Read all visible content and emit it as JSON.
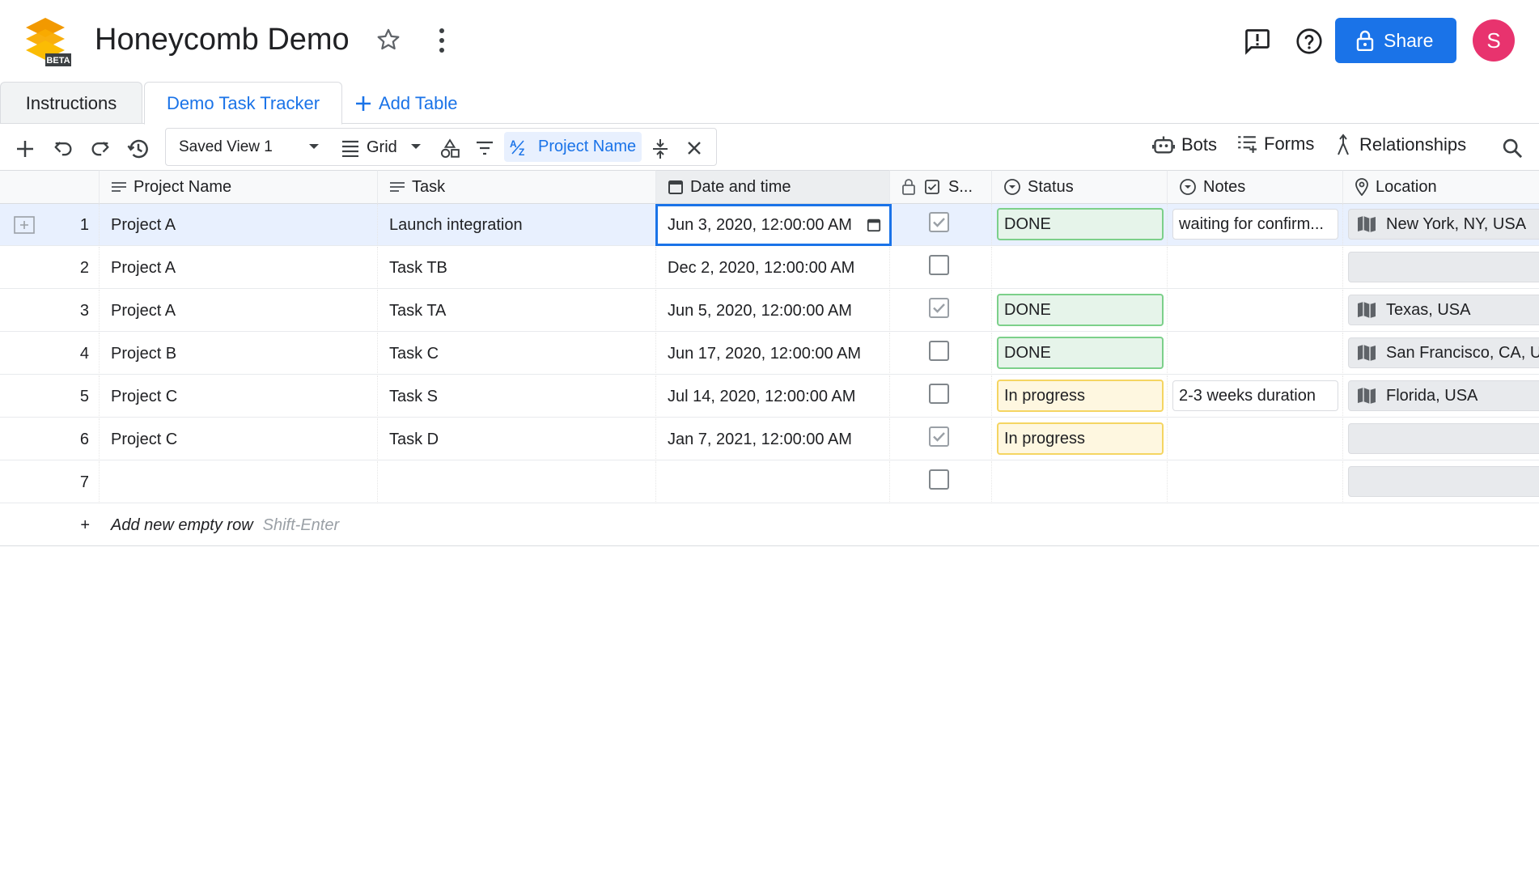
{
  "header": {
    "title": "Honeycomb Demo",
    "logo_badge": "BETA",
    "share_label": "Share",
    "avatar_initial": "S"
  },
  "tabs": [
    {
      "label": "Instructions",
      "active": false
    },
    {
      "label": "Demo Task Tracker",
      "active": true
    }
  ],
  "add_table_label": "Add Table",
  "toolbar": {
    "saved_view": "Saved View 1",
    "layout": "Grid",
    "sort_label": "Project Name",
    "bots": "Bots",
    "forms": "Forms",
    "relationships": "Relationships"
  },
  "columns": {
    "project_name": "Project Name",
    "task": "Task",
    "date_time": "Date and time",
    "checkbox": "S...",
    "status": "Status",
    "notes": "Notes",
    "location": "Location"
  },
  "rows": [
    {
      "num": "1",
      "project": "Project A",
      "task": "Launch integration",
      "date": "Jun 3, 2020, 12:00:00 AM",
      "checked": true,
      "status": "DONE",
      "notes": "waiting for confirm...",
      "location": "New York, NY, USA"
    },
    {
      "num": "2",
      "project": "Project A",
      "task": "Task TB",
      "date": "Dec 2, 2020, 12:00:00 AM",
      "checked": false,
      "status": "",
      "notes": "",
      "location": ""
    },
    {
      "num": "3",
      "project": "Project A",
      "task": "Task TA",
      "date": "Jun 5, 2020, 12:00:00 AM",
      "checked": true,
      "status": "DONE",
      "notes": "",
      "location": "Texas, USA"
    },
    {
      "num": "4",
      "project": "Project B",
      "task": "Task C",
      "date": "Jun 17, 2020, 12:00:00 AM",
      "checked": false,
      "status": "DONE",
      "notes": "",
      "location": "San Francisco, CA, US"
    },
    {
      "num": "5",
      "project": "Project C",
      "task": "Task S",
      "date": "Jul 14, 2020, 12:00:00 AM",
      "checked": false,
      "status": "In progress",
      "notes": "2-3 weeks duration",
      "location": "Florida, USA"
    },
    {
      "num": "6",
      "project": "Project C",
      "task": "Task D",
      "date": "Jan 7, 2021, 12:00:00 AM",
      "checked": true,
      "status": "In progress",
      "notes": "",
      "location": ""
    },
    {
      "num": "7",
      "project": "",
      "task": "",
      "date": "",
      "checked": false,
      "status": "",
      "notes": "",
      "location": ""
    }
  ],
  "add_row": {
    "plus": "+",
    "label": "Add new empty row",
    "shortcut": "Shift-Enter"
  },
  "colors": {
    "accent": "#1a73e8",
    "avatar": "#e8336e",
    "done_bg": "#e6f4ea",
    "done_border": "#7cd08a",
    "progress_bg": "#fef7e0",
    "progress_border": "#f5d562"
  }
}
